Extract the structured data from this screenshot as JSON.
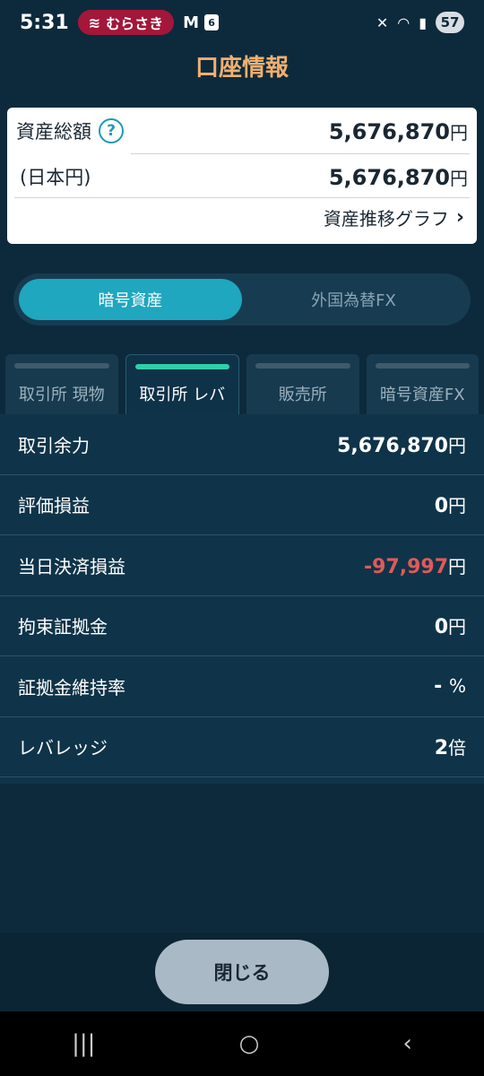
{
  "status": {
    "time": "5:31",
    "carrier": "むらさき",
    "notif_count": "6",
    "battery": "57"
  },
  "header": {
    "title": "口座情報"
  },
  "summary": {
    "total_label": "資産総額",
    "total_value": "5,676,870",
    "jpy_label": "(日本円)",
    "jpy_value": "5,676,870",
    "yen": "円",
    "graph_link": "資産推移グラフ"
  },
  "segment": {
    "options": [
      "暗号資産",
      "外国為替FX"
    ],
    "selected": "暗号資産"
  },
  "tabs": [
    {
      "label": "取引所 現物"
    },
    {
      "label": "取引所 レバ"
    },
    {
      "label": "販売所"
    },
    {
      "label": "暗号資産FX"
    }
  ],
  "details": [
    {
      "label": "取引余力",
      "value": "5,676,870",
      "unit": "円"
    },
    {
      "label": "評価損益",
      "value": "0",
      "unit": "円"
    },
    {
      "label": "当日決済損益",
      "value": "-97,997",
      "unit": "円"
    },
    {
      "label": "拘束証拠金",
      "value": "0",
      "unit": "円"
    },
    {
      "label": "証拠金維持率",
      "value": "-",
      "unit": "%"
    },
    {
      "label": "レバレッジ",
      "value": "2",
      "unit": "倍"
    }
  ],
  "footer": {
    "close_label": "閉じる"
  },
  "colors": {
    "accent": "#1ea7be",
    "title": "#f0b070",
    "negative": "#e05a5a",
    "active_tab_bar": "#2ecfa9"
  }
}
